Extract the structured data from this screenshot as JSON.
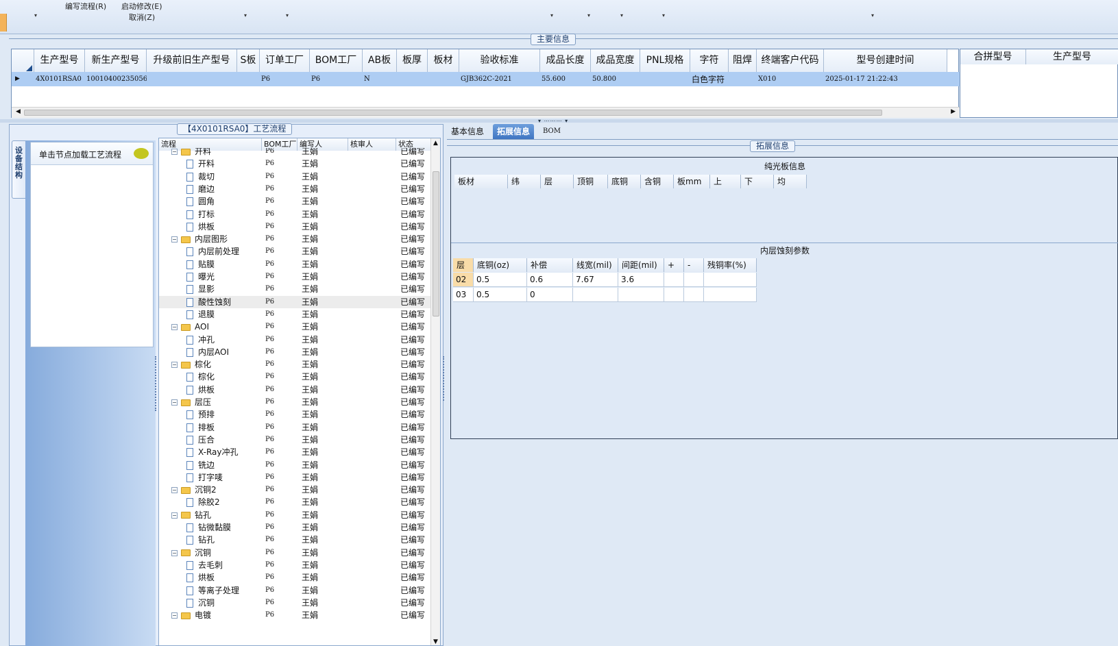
{
  "toolbar": {
    "write_flow": "编写流程(R)",
    "start_modify": "启动修改(E)",
    "cancel": "取消(Z)"
  },
  "main_info": {
    "title": "主要信息",
    "columns": [
      "生产型号",
      "新生产型号",
      "升级前旧生产型号",
      "S板",
      "订单工厂",
      "BOM工厂",
      "AB板",
      "板厚",
      "板材",
      "验收标准",
      "成品长度",
      "成品宽度",
      "PNL规格",
      "字符",
      "阻焊",
      "终端客户代码",
      "型号创建时间"
    ],
    "row": [
      "4X0101RSA0",
      "10010400235056",
      "",
      "",
      "P6",
      "P6",
      "N",
      "",
      "",
      "GJB362C-2021",
      "55.600",
      "50.800",
      "",
      "白色字符",
      "",
      "X010",
      "2025-01-17 21:22:43"
    ],
    "right_columns": [
      "合拼型号",
      "生产型号"
    ]
  },
  "left_panel": {
    "vertical_tab": "设备结构",
    "load_hint": "单击节点加载工艺流程"
  },
  "flow": {
    "title": "【4X0101RSA0】工艺流程",
    "columns": [
      "流程",
      "BOM工厂",
      "编写人",
      "核审人",
      "状态"
    ],
    "rows": [
      {
        "name": "开料",
        "folder": true,
        "bom": "P6",
        "writer": "王娟",
        "status": "已编写"
      },
      {
        "name": "开料",
        "folder": false,
        "bom": "P6",
        "writer": "王娟",
        "status": "已编写"
      },
      {
        "name": "裁切",
        "folder": false,
        "bom": "P6",
        "writer": "王娟",
        "status": "已编写"
      },
      {
        "name": "磨边",
        "folder": false,
        "bom": "P6",
        "writer": "王娟",
        "status": "已编写"
      },
      {
        "name": "圆角",
        "folder": false,
        "bom": "P6",
        "writer": "王娟",
        "status": "已编写"
      },
      {
        "name": "打标",
        "folder": false,
        "bom": "P6",
        "writer": "王娟",
        "status": "已编写"
      },
      {
        "name": "烘板",
        "folder": false,
        "bom": "P6",
        "writer": "王娟",
        "status": "已编写"
      },
      {
        "name": "内层图形",
        "folder": true,
        "bom": "P6",
        "writer": "王娟",
        "status": "已编写"
      },
      {
        "name": "内层前处理",
        "folder": false,
        "bom": "P6",
        "writer": "王娟",
        "status": "已编写"
      },
      {
        "name": "贴膜",
        "folder": false,
        "bom": "P6",
        "writer": "王娟",
        "status": "已编写"
      },
      {
        "name": "曝光",
        "folder": false,
        "bom": "P6",
        "writer": "王娟",
        "status": "已编写"
      },
      {
        "name": "显影",
        "folder": false,
        "bom": "P6",
        "writer": "王娟",
        "status": "已编写"
      },
      {
        "name": "酸性蚀刻",
        "folder": false,
        "bom": "P6",
        "writer": "王娟",
        "status": "已编写",
        "selected": true
      },
      {
        "name": "退膜",
        "folder": false,
        "bom": "P6",
        "writer": "王娟",
        "status": "已编写"
      },
      {
        "name": "AOI",
        "folder": true,
        "bom": "P6",
        "writer": "王娟",
        "status": "已编写"
      },
      {
        "name": "冲孔",
        "folder": false,
        "bom": "P6",
        "writer": "王娟",
        "status": "已编写"
      },
      {
        "name": "内层AOI",
        "folder": false,
        "bom": "P6",
        "writer": "王娟",
        "status": "已编写"
      },
      {
        "name": "棕化",
        "folder": true,
        "bom": "P6",
        "writer": "王娟",
        "status": "已编写"
      },
      {
        "name": "棕化",
        "folder": false,
        "bom": "P6",
        "writer": "王娟",
        "status": "已编写"
      },
      {
        "name": "烘板",
        "folder": false,
        "bom": "P6",
        "writer": "王娟",
        "status": "已编写"
      },
      {
        "name": "层压",
        "folder": true,
        "bom": "P6",
        "writer": "王娟",
        "status": "已编写"
      },
      {
        "name": "预排",
        "folder": false,
        "bom": "P6",
        "writer": "王娟",
        "status": "已编写"
      },
      {
        "name": "排板",
        "folder": false,
        "bom": "P6",
        "writer": "王娟",
        "status": "已编写"
      },
      {
        "name": "压合",
        "folder": false,
        "bom": "P6",
        "writer": "王娟",
        "status": "已编写"
      },
      {
        "name": "X-Ray冲孔",
        "folder": false,
        "bom": "P6",
        "writer": "王娟",
        "status": "已编写"
      },
      {
        "name": "铣边",
        "folder": false,
        "bom": "P6",
        "writer": "王娟",
        "status": "已编写"
      },
      {
        "name": "打字唛",
        "folder": false,
        "bom": "P6",
        "writer": "王娟",
        "status": "已编写"
      },
      {
        "name": "沉铜2",
        "folder": true,
        "bom": "P6",
        "writer": "王娟",
        "status": "已编写"
      },
      {
        "name": "除胶2",
        "folder": false,
        "bom": "P6",
        "writer": "王娟",
        "status": "已编写"
      },
      {
        "name": "钻孔",
        "folder": true,
        "bom": "P6",
        "writer": "王娟",
        "status": "已编写"
      },
      {
        "name": "钻微黏膜",
        "folder": false,
        "bom": "P6",
        "writer": "王娟",
        "status": "已编写"
      },
      {
        "name": "钻孔",
        "folder": false,
        "bom": "P6",
        "writer": "王娟",
        "status": "已编写"
      },
      {
        "name": "沉铜",
        "folder": true,
        "bom": "P6",
        "writer": "王娟",
        "status": "已编写"
      },
      {
        "name": "去毛刺",
        "folder": false,
        "bom": "P6",
        "writer": "王娟",
        "status": "已编写"
      },
      {
        "name": "烘板",
        "folder": false,
        "bom": "P6",
        "writer": "王娟",
        "status": "已编写"
      },
      {
        "name": "等离子处理",
        "folder": false,
        "bom": "P6",
        "writer": "王娟",
        "status": "已编写"
      },
      {
        "name": "沉铜",
        "folder": false,
        "bom": "P6",
        "writer": "王娟",
        "status": "已编写"
      },
      {
        "name": "电镀",
        "folder": true,
        "bom": "P6",
        "writer": "王娟",
        "status": "已编写"
      }
    ]
  },
  "tabs": [
    "基本信息",
    "拓展信息",
    "BOM"
  ],
  "ext": {
    "title": "拓展信息",
    "bare_board_title": "纯光板信息",
    "bare_board_cols": [
      "板材",
      "纬",
      "层",
      "顶铜",
      "底铜",
      "含铜",
      "板mm",
      "上",
      "下",
      "均"
    ],
    "etch_title": "内层蚀刻参数",
    "etch_cols": [
      "层",
      "底铜(oz)",
      "补偿",
      "线宽(mil)",
      "间距(mil)",
      "+",
      "-",
      "残铜率(%)"
    ],
    "etch_rows": [
      [
        "02",
        "0.5",
        "0.6",
        "7.67",
        "3.6",
        "",
        "",
        ""
      ],
      [
        "03",
        "0.5",
        "0",
        "",
        "",
        "",
        "",
        ""
      ]
    ]
  }
}
